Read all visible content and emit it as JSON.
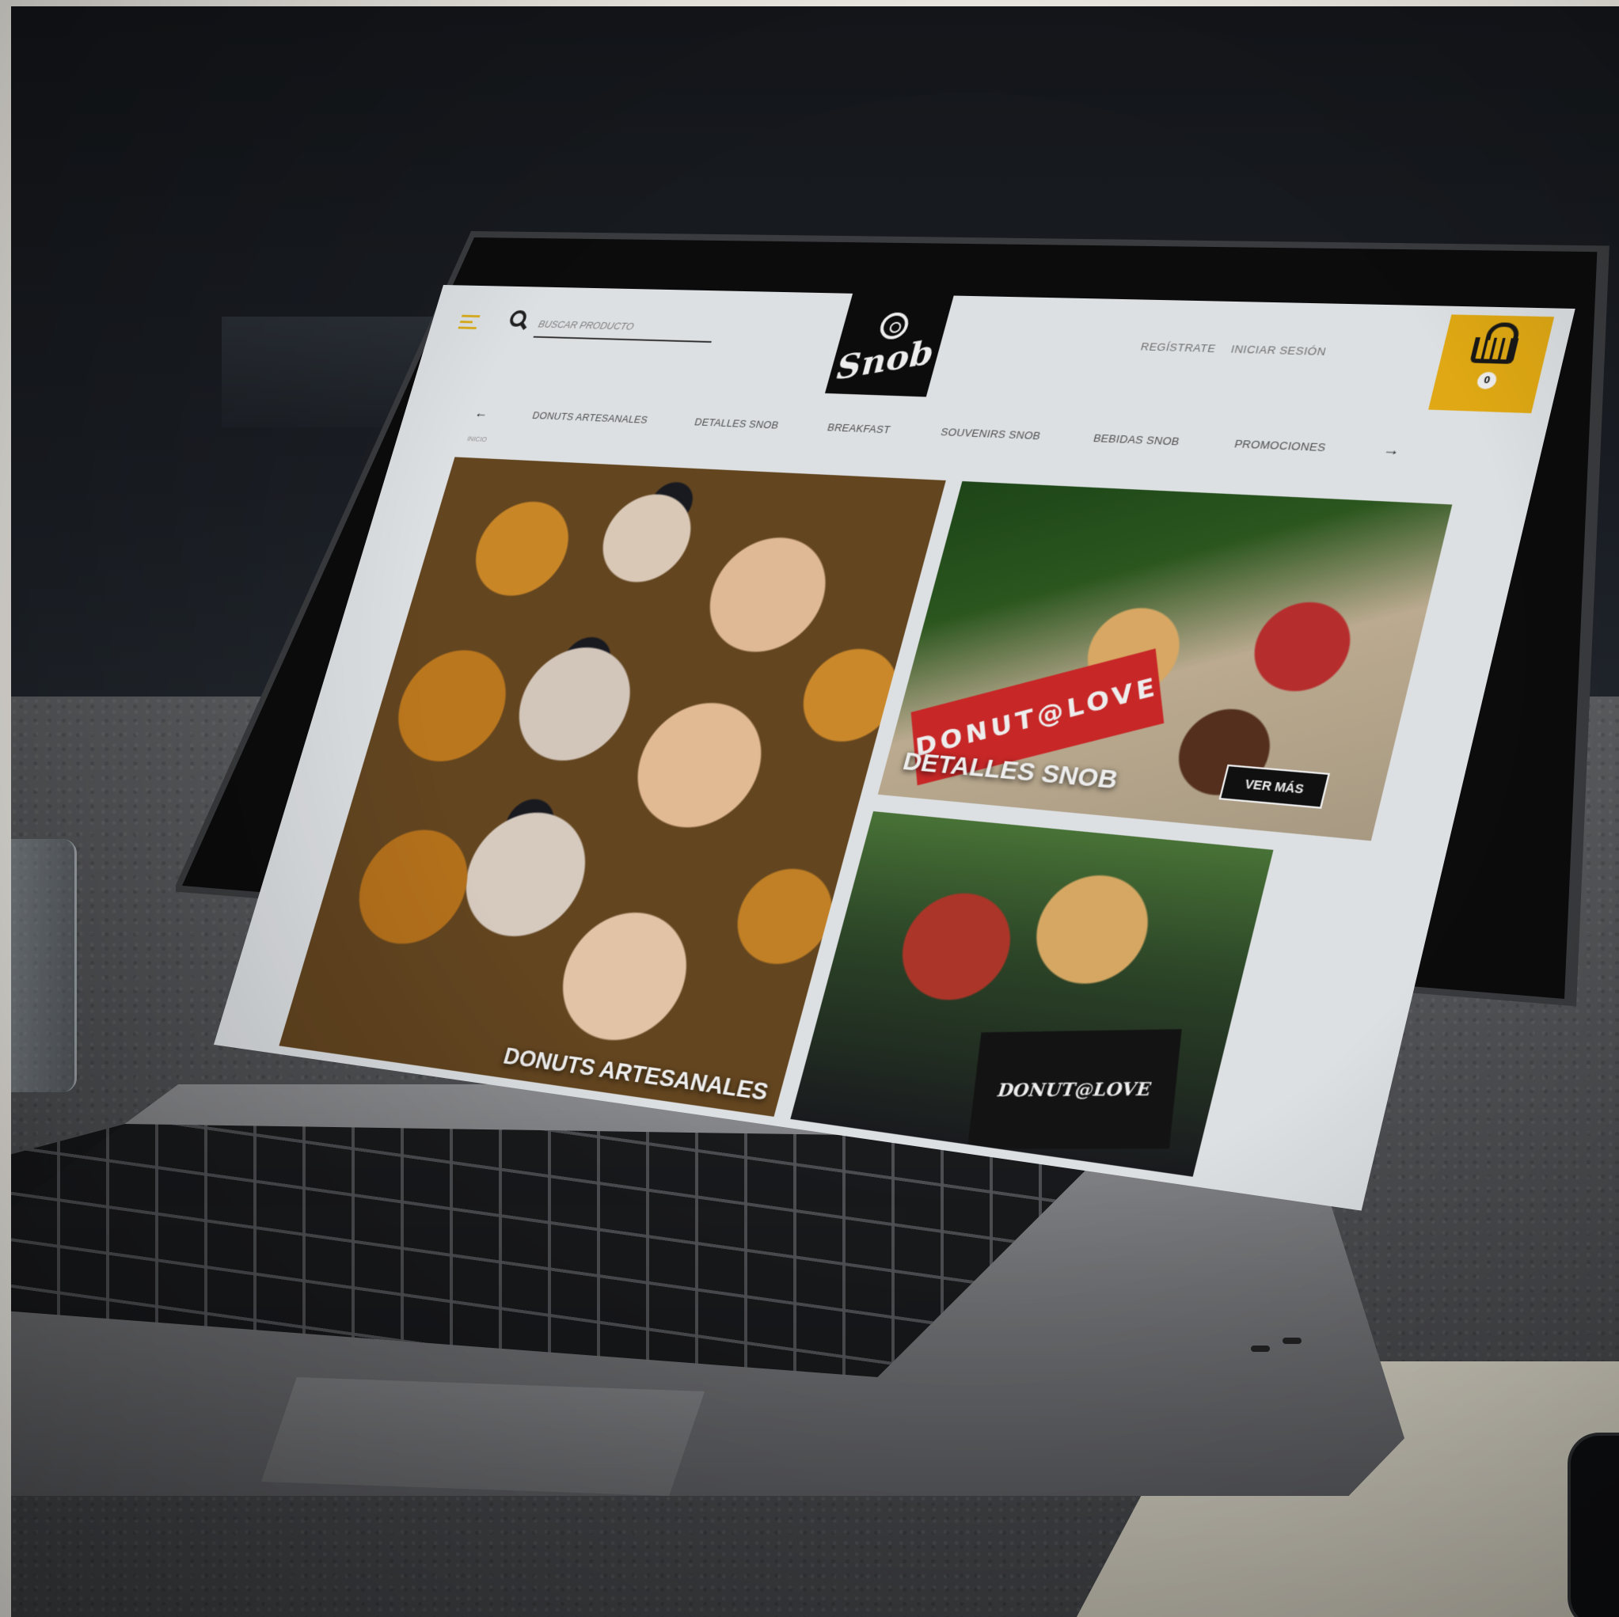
{
  "search": {
    "placeholder": "BUSCAR PRODUCTO"
  },
  "brand": {
    "logo_text": "Snob"
  },
  "account": {
    "register": "REGÍSTRATE",
    "login": "INICIAR SESIÓN"
  },
  "cart": {
    "count": "0"
  },
  "categories": {
    "prev_arrow": "←",
    "next_arrow": "→",
    "items": [
      {
        "label": "DONUTS ARTESANALES"
      },
      {
        "label": "DETALLES SNOB"
      },
      {
        "label": "BREAKFAST"
      },
      {
        "label": "SOUVENIRS SNOB"
      },
      {
        "label": "BEBIDAS SNOB"
      },
      {
        "label": "PROMOCIONES"
      }
    ],
    "breadcrumb": "INICIO"
  },
  "tiles": {
    "main_caption": "DONUTS ARTESANALES",
    "detalles_title": "DETALLES SNOB",
    "detalles_button": "VER MÁS",
    "band_text": "DONUT@LOVE",
    "box_text": "DONUT@LOVE"
  },
  "colors": {
    "accent": "#f0b515",
    "logo_bg": "#0d0d0d",
    "band_red": "#d62a2a"
  }
}
